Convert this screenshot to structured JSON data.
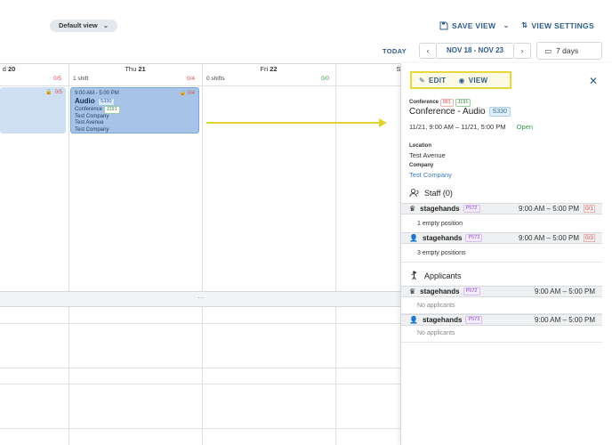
{
  "toolbar": {
    "view_pill": "Default view",
    "save_view": "SAVE VIEW",
    "view_settings": "VIEW SETTINGS",
    "today": "TODAY",
    "date_range": "NOV 18 - NOV 23",
    "days": "7 days"
  },
  "calendar": {
    "days": [
      {
        "label": "d",
        "num": "20",
        "shifts": "",
        "count": "0/5",
        "count_color": "#d9534f"
      },
      {
        "label": "Thu",
        "num": "21",
        "shifts": "1 shift",
        "count": "0/4",
        "count_color": "#d9534f"
      },
      {
        "label": "Fri",
        "num": "22",
        "shifts": "0 shifts",
        "count": "0/0",
        "count_color": "#2d9a48"
      },
      {
        "label": "Sa",
        "num": "",
        "shifts": "",
        "count": "",
        "count_color": "#333"
      }
    ],
    "card_left": {
      "count": "0/5"
    },
    "card_main": {
      "time": "9:00 AM - 5:00 PM",
      "count": "0/4",
      "title": "Audio",
      "title_tag": "S330",
      "conference": "Conference",
      "job_tag": "J191",
      "company": "Test Company",
      "location": "Test Avenue",
      "company2": "Test Company"
    },
    "band_dots": "···"
  },
  "panel": {
    "edit": "EDIT",
    "view": "VIEW",
    "close": "✕",
    "event_type": "Conference",
    "tag1": "881",
    "tag2": "J191",
    "title": "Conference - Audio",
    "title_tag": "S330",
    "datetime": "11/21, 9:00 AM – 11/21, 5:00 PM",
    "status": "Open",
    "location_label": "Location",
    "location": "Test Avenue",
    "company_label": "Company",
    "company": "Test Company",
    "staff_title": "Staff (0)",
    "staff_rows": [
      {
        "name": "stagehands",
        "tag": "P572",
        "time": "9:00 AM – 5:00 PM",
        "count": "0/1",
        "sub": "1 empty position"
      },
      {
        "name": "stagehands",
        "tag": "P573",
        "time": "9:00 AM – 5:00 PM",
        "count": "0/3",
        "sub": "3 empty positions"
      }
    ],
    "applicants_title": "Applicants",
    "applicant_rows": [
      {
        "name": "stagehands",
        "tag": "P572",
        "time": "9:00 AM – 5:00 PM",
        "sub": "No applicants"
      },
      {
        "name": "stagehands",
        "tag": "P573",
        "time": "9:00 AM – 5:00 PM",
        "sub": "No applicants"
      }
    ]
  }
}
